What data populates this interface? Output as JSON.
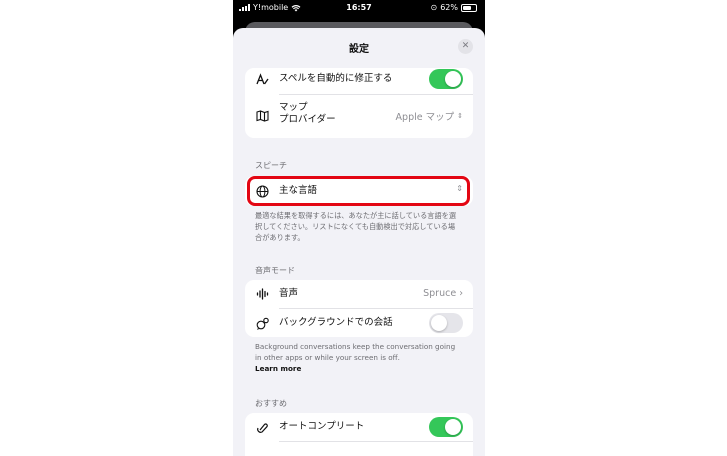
{
  "status_bar": {
    "carrier": "Y!mobile",
    "time": "16:57",
    "battery": "62%"
  },
  "sheet": {
    "title": "設定",
    "close_icon": "close-icon"
  },
  "general": {
    "spell_row": {
      "label": "スペルを自動的に修正する",
      "icon": "text-format-icon",
      "toggle_on": true
    },
    "map_row": {
      "label_line1": "マップ",
      "label_line2": "プロバイダー",
      "value": "Apple マップ",
      "icon": "map-icon"
    }
  },
  "speech": {
    "header": "スピーチ",
    "language_row": {
      "label": "主な言語",
      "icon": "globe-icon"
    },
    "note": "最適な結果を取得するには、あなたが主に話している言語を選択してください。リストになくても自動検出で対応している場合があります。"
  },
  "voice_mode": {
    "header": "音声モード",
    "voice_row": {
      "label": "音声",
      "value": "Spruce",
      "icon": "waveform-icon"
    },
    "background_row": {
      "label": "バックグラウンドでの会話",
      "icon": "background-chat-icon",
      "toggle_on": false
    },
    "note": "Background conversations keep the conversation going in other apps or while your screen is off.",
    "learn_more": "Learn more"
  },
  "recommended": {
    "header": "おすすめ",
    "autocomplete_row": {
      "label": "オートコンプリート",
      "icon": "autocomplete-icon",
      "toggle_on": true
    }
  },
  "colors": {
    "toggle_on": "#34c759",
    "highlight": "#e30613"
  }
}
